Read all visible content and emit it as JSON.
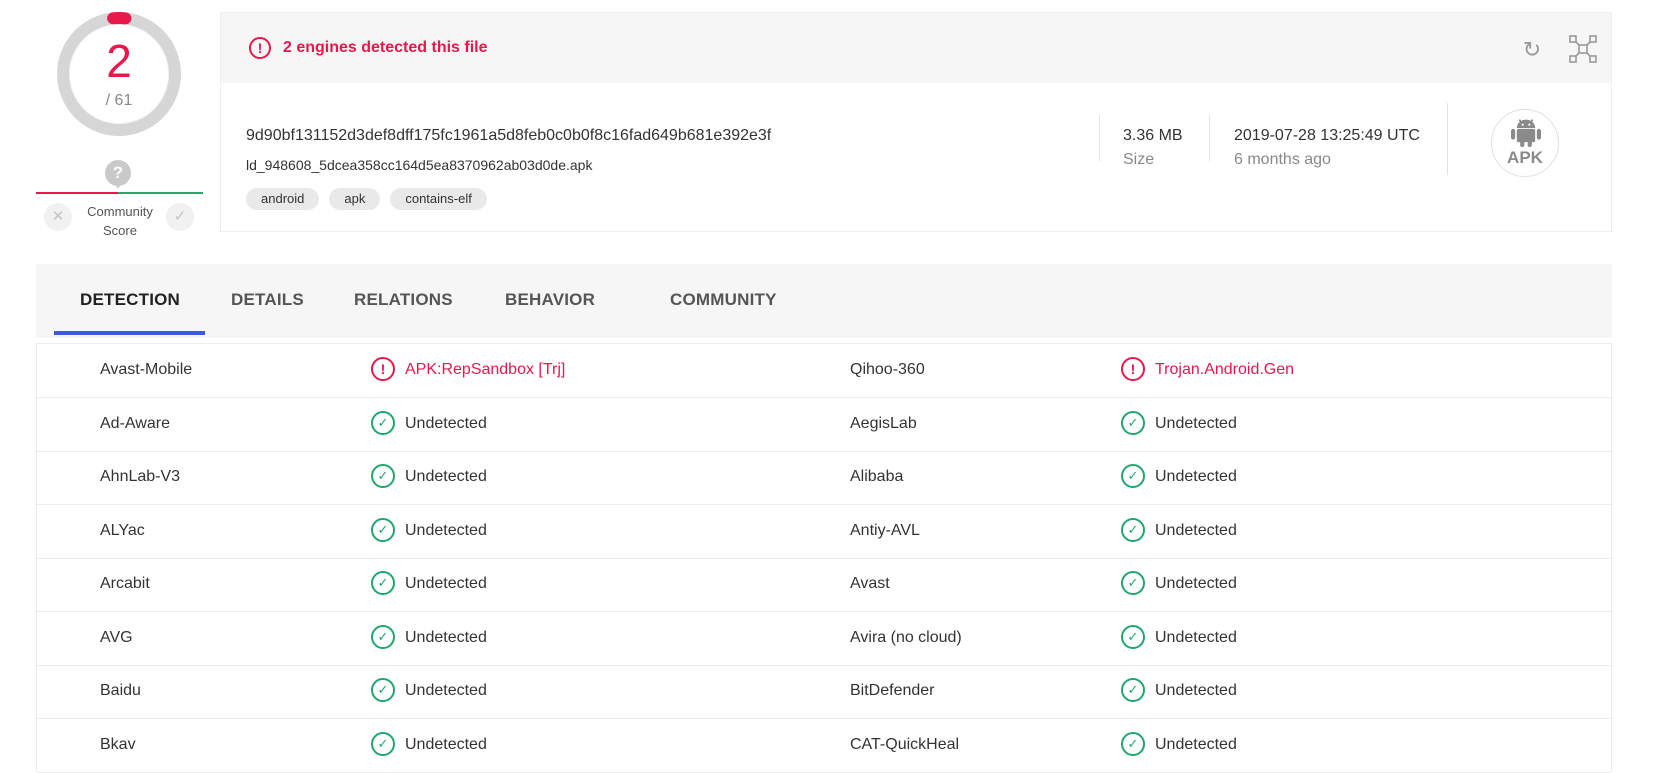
{
  "score": {
    "detections": "2",
    "total": "/ 61",
    "detection_fraction": 0.0328,
    "community_label_line1": "Community",
    "community_label_line2": "Score",
    "community_question": "?"
  },
  "file": {
    "alert": "2 engines detected this file",
    "hash": "9d90bf131152d3def8dff175fc1961a5d8feb0c0b0f8c16fad649b681e392e3f",
    "filename": "ld_948608_5dcea358cc164d5ea8370962ab03d0de.apk",
    "tags": [
      "android",
      "apk",
      "contains-elf"
    ],
    "size_value": "3.36 MB",
    "size_label": "Size",
    "date_value": "2019-07-28 13:25:49 UTC",
    "date_label": "6 months ago",
    "type_badge": "APK",
    "type_icon": "android-icon"
  },
  "tabs": [
    "DETECTION",
    "DETAILS",
    "RELATIONS",
    "BEHAVIOR",
    "COMMUNITY"
  ],
  "active_tab": "DETECTION",
  "colors": {
    "malicious": "#e8184b",
    "clean": "#20a86c",
    "tab_underline": "#3b5bdb"
  },
  "detections": [
    {
      "left_engine": "Avast-Mobile",
      "left_result": "APK:RepSandbox [Trj]",
      "left_status": "malicious",
      "right_engine": "Qihoo-360",
      "right_result": "Trojan.Android.Gen",
      "right_status": "malicious"
    },
    {
      "left_engine": "Ad-Aware",
      "left_result": "Undetected",
      "left_status": "clean",
      "right_engine": "AegisLab",
      "right_result": "Undetected",
      "right_status": "clean"
    },
    {
      "left_engine": "AhnLab-V3",
      "left_result": "Undetected",
      "left_status": "clean",
      "right_engine": "Alibaba",
      "right_result": "Undetected",
      "right_status": "clean"
    },
    {
      "left_engine": "ALYac",
      "left_result": "Undetected",
      "left_status": "clean",
      "right_engine": "Antiy-AVL",
      "right_result": "Undetected",
      "right_status": "clean"
    },
    {
      "left_engine": "Arcabit",
      "left_result": "Undetected",
      "left_status": "clean",
      "right_engine": "Avast",
      "right_result": "Undetected",
      "right_status": "clean"
    },
    {
      "left_engine": "AVG",
      "left_result": "Undetected",
      "left_status": "clean",
      "right_engine": "Avira (no cloud)",
      "right_result": "Undetected",
      "right_status": "clean"
    },
    {
      "left_engine": "Baidu",
      "left_result": "Undetected",
      "left_status": "clean",
      "right_engine": "BitDefender",
      "right_result": "Undetected",
      "right_status": "clean"
    },
    {
      "left_engine": "Bkav",
      "left_result": "Undetected",
      "left_status": "clean",
      "right_engine": "CAT-QuickHeal",
      "right_result": "Undetected",
      "right_status": "clean"
    }
  ]
}
